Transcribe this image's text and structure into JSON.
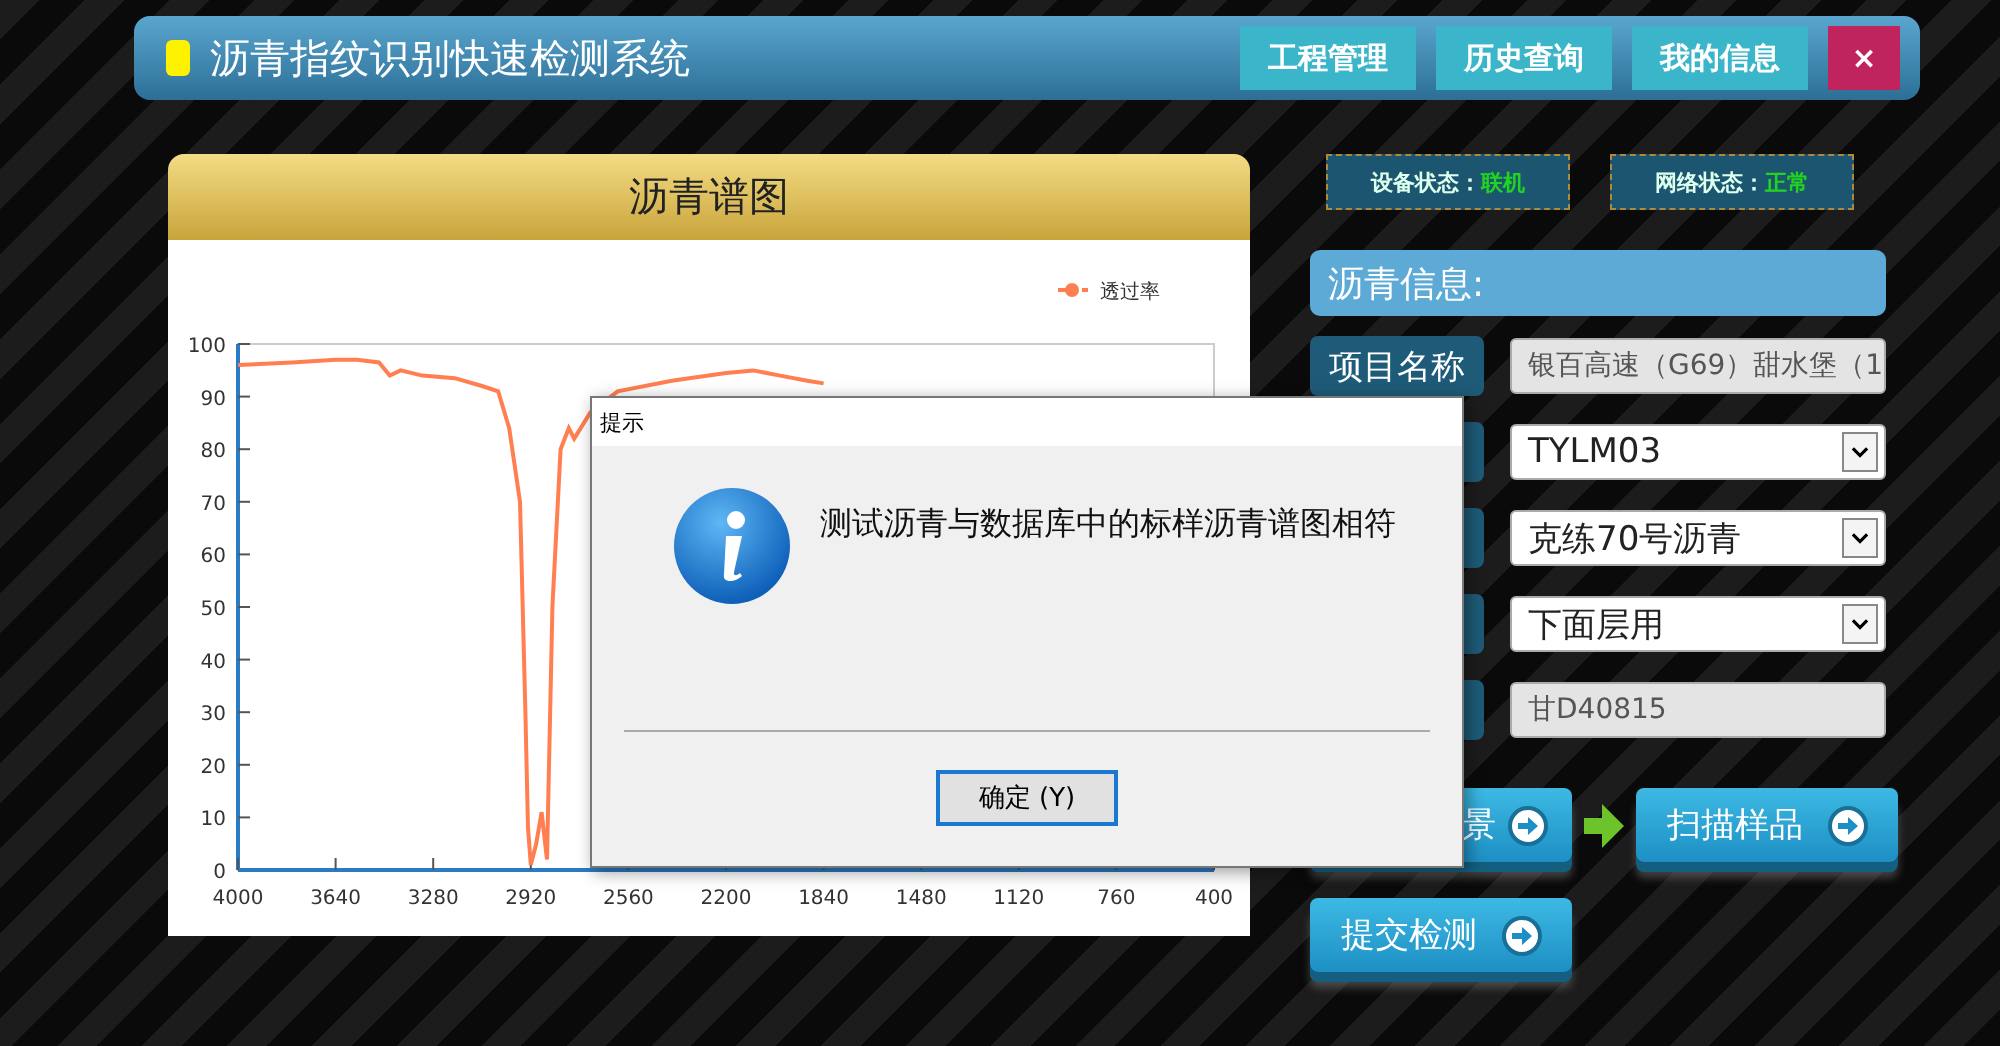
{
  "header": {
    "title": "沥青指纹识别快速检测系统",
    "nav": [
      {
        "label": "工程管理",
        "kind": "nav"
      },
      {
        "label": "历史查询",
        "kind": "nav"
      },
      {
        "label": "我的信息",
        "kind": "nav"
      },
      {
        "label": "×",
        "kind": "close"
      }
    ]
  },
  "spectrum_panel": {
    "title": "沥青谱图",
    "chart_data": {
      "type": "line",
      "x": [
        4000,
        3800,
        3640,
        3560,
        3480,
        3440,
        3400,
        3320,
        3200,
        3100,
        3040,
        3000,
        2960,
        2940,
        2930,
        2920,
        2900,
        2880,
        2860,
        2840,
        2810,
        2780,
        2760,
        2700,
        2600,
        2400,
        2200,
        2100,
        2000,
        1900,
        1840
      ],
      "series": [
        {
          "name": "透过率",
          "color": "#ff7f50",
          "values": [
            96,
            96.5,
            97,
            97,
            96.5,
            94,
            95,
            94,
            93.5,
            92,
            91,
            84,
            70,
            30,
            8,
            1,
            5,
            11,
            2,
            50,
            80,
            84,
            82,
            87,
            91,
            93,
            94.5,
            95,
            94,
            93,
            92.5
          ]
        }
      ],
      "xlim": [
        4000,
        400
      ],
      "ylim": [
        0,
        100
      ],
      "xticks": [
        4000,
        3640,
        3280,
        2920,
        2560,
        2200,
        1840,
        1480,
        1120,
        760,
        400
      ],
      "yticks": [
        0,
        10,
        20,
        30,
        40,
        50,
        60,
        70,
        80,
        90,
        100
      ]
    }
  },
  "status": [
    {
      "label": "设备状态：",
      "value": "联机"
    },
    {
      "label": "网络状态：",
      "value": "正常"
    }
  ],
  "info": {
    "title": "沥青信息:",
    "rows": [
      {
        "label": "项目名称",
        "kind": "input",
        "value": "银百高速（G69）甜水堡（1"
      },
      {
        "kind": "select",
        "value": "TYLM03"
      },
      {
        "kind": "select",
        "value": "克练70号沥青"
      },
      {
        "kind": "select",
        "value": "下面层用"
      },
      {
        "kind": "input",
        "value": "甘D40815"
      }
    ]
  },
  "actions": [
    {
      "label": "景",
      "kind": "action"
    },
    {
      "kind": "arrow"
    },
    {
      "label": "扫描样品",
      "kind": "action"
    },
    {
      "label": "提交检测",
      "kind": "action"
    }
  ],
  "dialog": {
    "title": "提示",
    "message": "测试沥青与数据库中的标样沥青谱图相符",
    "button": "确定 (Y)"
  }
}
